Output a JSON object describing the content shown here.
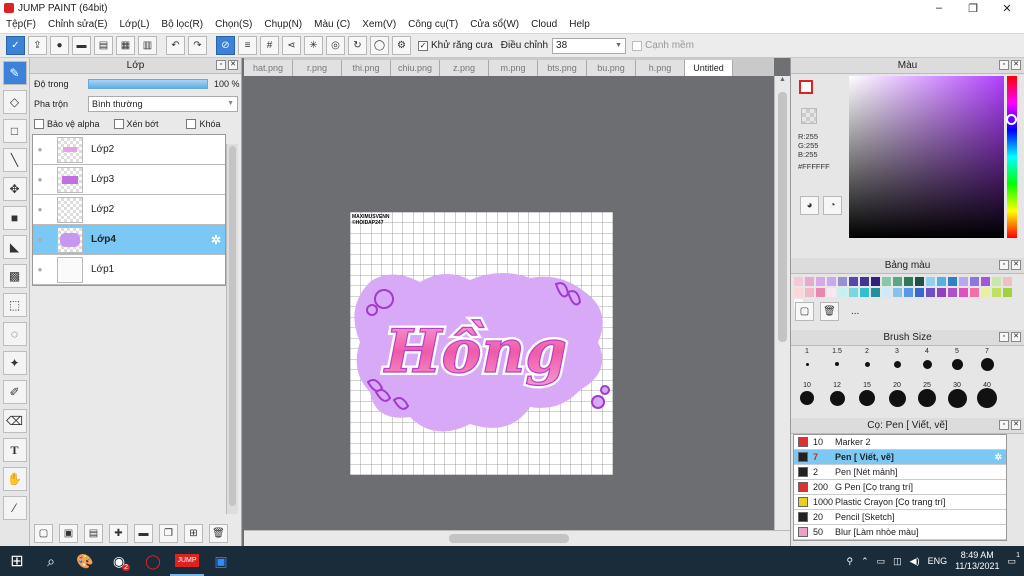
{
  "window": {
    "title": "JUMP PAINT (64bit)",
    "min": "–",
    "max": "❐",
    "close": "✕"
  },
  "menu": [
    "Tệp(F)",
    "Chỉnh sửa(E)",
    "Lớp(L)",
    "Bộ lọc(R)",
    "Chọn(S)",
    "Chụp(N)",
    "Màu (C)",
    "Xem(V)",
    "Công cụ(T)",
    "Cửa sổ(W)",
    "Cloud",
    "Help"
  ],
  "toolbar": {
    "antialias_label": "Khử răng cưa",
    "adjust_label": "Điều chỉnh",
    "adjust_value": "38",
    "snap_label": "Cạnh mềm"
  },
  "layer_panel": {
    "title": "Lớp",
    "opacity_label": "Độ trong",
    "opacity_value": "100 %",
    "opacity_fraction": 1.0,
    "blend_label": "Pha trộn",
    "blend_value": "Bình thường",
    "protect_alpha": "Bảo vệ alpha",
    "clipping": "Xén bớt",
    "lock": "Khóa",
    "layers": [
      {
        "name": "Lớp2",
        "selected": false
      },
      {
        "name": "Lớp3",
        "selected": false
      },
      {
        "name": "Lớp2",
        "selected": false
      },
      {
        "name": "Lớp4",
        "selected": true
      },
      {
        "name": "Lớp1",
        "selected": false
      }
    ]
  },
  "doc_tabs": [
    {
      "label": "hat.png"
    },
    {
      "label": "r.png"
    },
    {
      "label": "thi.png"
    },
    {
      "label": "chiu.png"
    },
    {
      "label": "z.png"
    },
    {
      "label": "m.png"
    },
    {
      "label": "bts.png"
    },
    {
      "label": "bu.png"
    },
    {
      "label": "h.png"
    },
    {
      "label": "Untitled",
      "active": true
    }
  ],
  "artwork": {
    "text": "Hồng",
    "watermark_line1": "MAXIMUSVENN",
    "watermark_line2": "©HOIDAP247"
  },
  "color_panel": {
    "title": "Màu",
    "r": "R:255",
    "g": "G:255",
    "b": "B:255",
    "hex": "#FFFFFF"
  },
  "palette_panel": {
    "title": "Bảng màu",
    "more": "..."
  },
  "brush_size_panel": {
    "title": "Brush Size",
    "row1": [
      "1",
      "1.5",
      "2",
      "3",
      "4",
      "5",
      "7"
    ],
    "row2": [
      "10",
      "12",
      "15",
      "20",
      "25",
      "30",
      "40"
    ]
  },
  "brush_panel": {
    "title": "Cọ: Pen [ Viết, vẽ]",
    "items": [
      {
        "size": "10",
        "name": "Marker 2",
        "color": "#e03030",
        "selected": false
      },
      {
        "size": "7",
        "name": "Pen [ Viết, vẽ]",
        "color": "#222222",
        "selected": true
      },
      {
        "size": "2",
        "name": "Pen [Nét mảnh]",
        "color": "#222222",
        "selected": false
      },
      {
        "size": "200",
        "name": "G Pen [Cọ trang trí]",
        "color": "#e03030",
        "selected": false
      },
      {
        "size": "1000",
        "name": "Plastic Crayon [Cọ trang trí]",
        "color": "#e8d020",
        "selected": false
      },
      {
        "size": "20",
        "name": "Pencil [Sketch]",
        "color": "#222222",
        "selected": false
      },
      {
        "size": "50",
        "name": "Blur [Làm nhòe màu]",
        "color": "#f0a0c8",
        "selected": false
      }
    ]
  },
  "taskbar": {
    "time": "8:49 AM",
    "date": "11/13/2021",
    "lang": "ENG",
    "badge": "2",
    "notif": "1"
  },
  "colors": {
    "accent": "#3b82d8",
    "selection": "#7cc8f5",
    "lavender": "#d6a9f5",
    "pink": "#f05aa8"
  }
}
